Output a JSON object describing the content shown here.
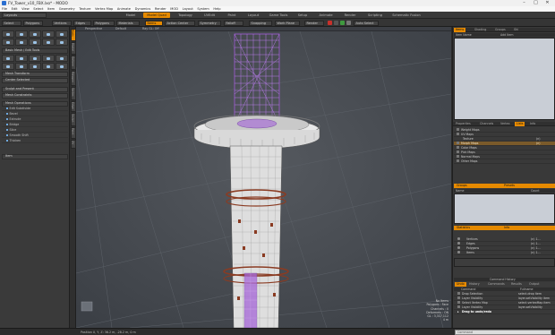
{
  "window": {
    "title": "FV_Tower_v10_FBX.lxo* - MODO",
    "controls": [
      "–",
      "□",
      "✕"
    ]
  },
  "menu": [
    "File",
    "Edit",
    "View",
    "Select",
    "Item",
    "Geometry",
    "Texture",
    "Vertex Map",
    "Animate",
    "Dynamics",
    "Render",
    "MOD",
    "Layout",
    "System",
    "Help"
  ],
  "layout": {
    "selector": "Layouts",
    "tabs": [
      "Model",
      "Model Quad",
      "Topology",
      "UVEdit",
      "Paint",
      "Layout",
      "Game Tools",
      "Setup",
      "Animate",
      "Render",
      "Scripting",
      "Schematic Fusion"
    ],
    "active_tab": "Model Quad"
  },
  "toolbar": {
    "items": [
      "Select",
      "Polygons",
      "Vertices",
      "Edges",
      "Polygons",
      "Materials",
      "Items",
      "Action Center",
      "Symmetry",
      "Falloff",
      "Snapping",
      "Work Plane",
      "Render",
      "Vertex Map",
      "Auto Select"
    ],
    "active": "Items",
    "falloff_label": "Falloff",
    "snapping_label": "Snapping",
    "workplane_label": "Work Plane",
    "render_label": "Render",
    "autoselect_label": "Auto Select"
  },
  "left_panel": {
    "preset_label": "Basic Mesh / Edit Tools",
    "mesh_transform": "Mesh Transform",
    "center_selected": "Center Selected",
    "sculpt_and_present": "Sculpt and Present",
    "mesh_constraints": "Mesh Constraints",
    "mesh_operations_header": "Mesh Operations",
    "tools": [
      "Edit Subdivide",
      "Bevel",
      "Extrude",
      "Bridge",
      "Slice",
      "Smooth Shift",
      "Thicken"
    ],
    "section": "Item"
  },
  "side_tabs": [
    "Basic",
    "Model",
    "Deform",
    "Polygon",
    "Vertex",
    "Edge",
    "Sculpt",
    "Paint",
    "UV"
  ],
  "viewport": {
    "header": [
      "Perspective",
      "Default",
      "Ray GL: Off"
    ],
    "info_lines": [
      "No Items",
      "Polygons : Face",
      "Channels : 0",
      "Deformers : ON",
      "GL : 3,317,112",
      "4 m"
    ],
    "background": "#454a52",
    "wire_color": "#9b59d0",
    "tower_color": "#d7d7d7",
    "rust_color": "#8a3b22"
  },
  "right_panel": {
    "top_tabs": [
      "Items",
      "Shading",
      "Groups",
      "Shi"
    ],
    "top_tab_active": "Items",
    "items_header": [
      "Item Name",
      "Add Item"
    ],
    "mid_tabs": [
      "Properties",
      "Channels",
      "Vertex",
      "Lists",
      "Info"
    ],
    "mid_tab_active": "Lists",
    "maps": [
      {
        "label": "Weight Maps",
        "value": ""
      },
      {
        "label": "UV Maps",
        "value": ""
      },
      {
        "label": "Texture",
        "value": "(n)"
      },
      {
        "label": "Morph Maps",
        "value": "(n)"
      },
      {
        "label": "Color Maps",
        "value": ""
      },
      {
        "label": "Pick Maps",
        "value": ""
      },
      {
        "label": "Normal Maps",
        "value": ""
      },
      {
        "label": "Other Maps",
        "value": ""
      }
    ],
    "selected_map": "Morph Maps",
    "groups_tabs": [
      "Groups",
      "Presets"
    ],
    "groups_header": [
      "Name",
      "Count"
    ],
    "stats_tabs": [
      "Statistics",
      "Info"
    ],
    "stats": [
      {
        "label": "Vertices",
        "value": "(n) 1..."
      },
      {
        "label": "Edges",
        "value": "(n) 1..."
      },
      {
        "label": "Polygons",
        "value": "(n) 1..."
      },
      {
        "label": "Items",
        "value": "(n) 1..."
      }
    ],
    "history_title": "Command History",
    "history_tabs": [
      "Undo",
      "History",
      "Commands",
      "Results",
      "Output"
    ],
    "history_header": [
      "Command",
      "Fullname"
    ],
    "history": [
      {
        "cmd": "Drop Selection",
        "full": "select.drop item"
      },
      {
        "cmd": "Layer Visibility",
        "full": "layer.setVisibility item"
      },
      {
        "cmd": "Select Vertex Map",
        "full": "select.vertexMap item"
      },
      {
        "cmd": "Layer Visibility",
        "full": "layer.setVisibility"
      },
      {
        "cmd": "Drag to undo/redo",
        "full": ""
      }
    ]
  },
  "status": {
    "position": "Position X, Y, Z:   36.2 m, -28.2 m, 0 m",
    "command_placeholder": "Command"
  }
}
